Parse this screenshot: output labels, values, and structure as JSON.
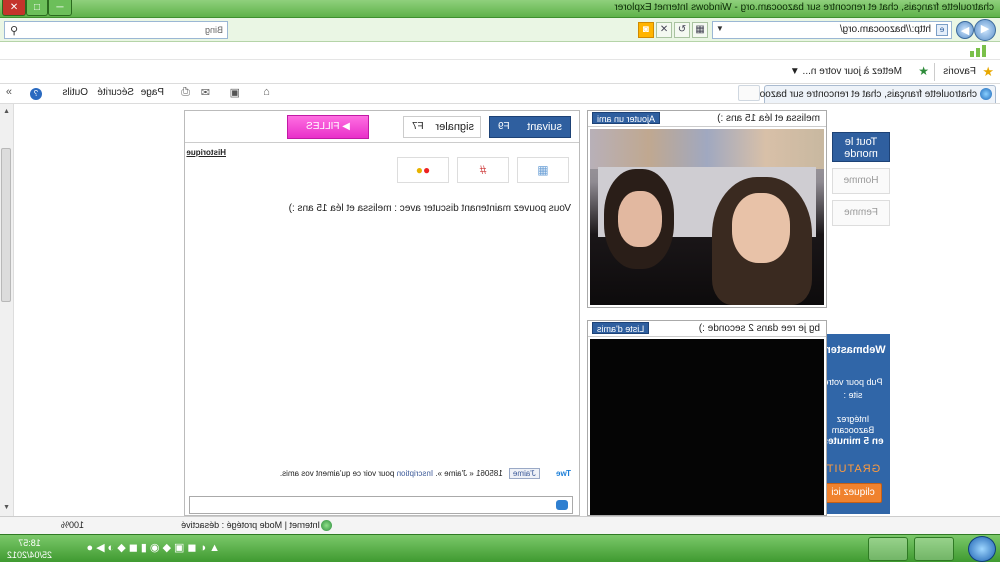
{
  "window": {
    "title": "chatroulette français, chat et rencontre sur bazoocam.org - Windows Internet Explorer",
    "min": "─",
    "max": "□",
    "close": "✕"
  },
  "address_bar": {
    "url": "http://bazoocam.org/",
    "search_placeholder": "Bing",
    "back": "◀",
    "forward": "▶",
    "compat": "▦",
    "refresh": "↻",
    "stop": "✕",
    "rss": "◙",
    "page_icon": "e",
    "dropdown": "▼",
    "search_icon": "⚲"
  },
  "favorites_bar": {
    "label": "Favoris",
    "add_icon": "★",
    "update_item": "Mettez à jour votre n...",
    "update_dropdown": "▼"
  },
  "command_bar": {
    "tab_title": "chatroulette français, chat et rencontre sur bazoo...",
    "home": "⌂",
    "feeds": "▣",
    "mail": "✉",
    "print": "⎙",
    "page": "Page",
    "securite": "Sécurité",
    "outils": "Outils",
    "help": "?",
    "more": "»"
  },
  "filters": {
    "tout": "Tout le monde",
    "homme": "Homme",
    "femme": "Femme"
  },
  "webmasters_ad": {
    "heading": "Webmasters",
    "line1": "Pub pour votre site :",
    "line2": "Intégrez Bazoocam",
    "line3": "en 5 minutes",
    "gratuit": "GRATUIT",
    "cta": "cliquez ici"
  },
  "partner": {
    "name": "melissa et léa 15 ans :)",
    "add_friend": "Ajouter un ami"
  },
  "self": {
    "name": "bg je ree dans 2 seconde :)",
    "friends_list": "Liste d'amis"
  },
  "chat": {
    "suivant": "suivant",
    "suivant_key": "F9",
    "signaler": "signaler",
    "signaler_key": "F7",
    "filles": "▶ FILLES",
    "historique": "Historique",
    "message": "Vous pouvez maintenant discuter avec : melissa et léa 15 ans :)",
    "tweet": "Twe",
    "like": "J'aime",
    "like_count": "185061",
    "like_text": "« J'aime ».",
    "inscription": "Inscription",
    "like_suffix": "pour voir ce qu'aiment vos amis."
  },
  "status_bar": {
    "zone": "Internet | Mode protégé : désactivé",
    "zoom": "100%"
  },
  "taskbar": {
    "time": "18:57",
    "date": "25/04/2012"
  }
}
